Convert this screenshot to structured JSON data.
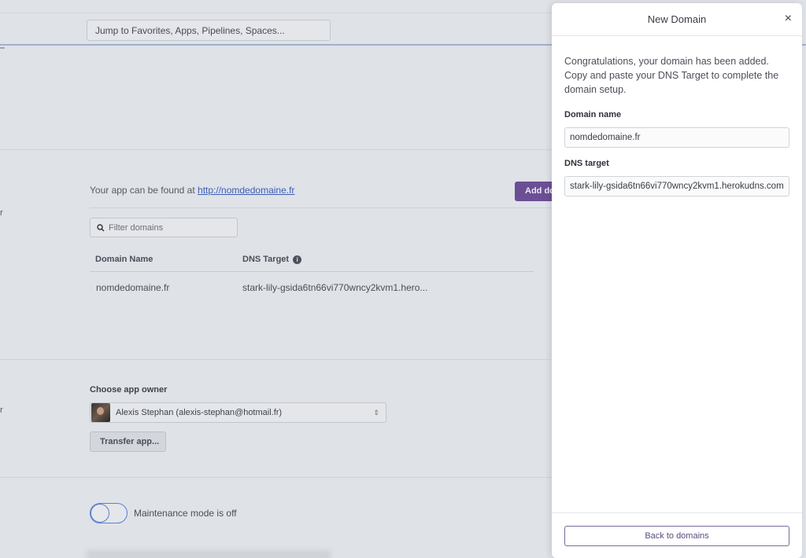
{
  "header": {
    "search_placeholder": "Jump to Favorites, Apps, Pipelines, Spaces..."
  },
  "domains_section": {
    "found_prefix": "Your app can be found at",
    "found_link": "http://nomdedomaine.fr",
    "add_button_label": "Add do",
    "filter_placeholder": "Filter domains",
    "columns": [
      "Domain Name",
      "DNS Target"
    ],
    "rows": [
      {
        "domain": "nomdedomaine.fr",
        "dns_target": "stark-lily-gsida6tn66vi770wncy2kvm1.hero..."
      }
    ]
  },
  "owner_section": {
    "label": "Choose app owner",
    "selected_owner": "Alexis Stephan (alexis-stephan@hotmail.fr)",
    "transfer_button": "Transfer app..."
  },
  "maintenance": {
    "label": "Maintenance mode is off",
    "enabled": false
  },
  "side_letters": [
    "r",
    "r"
  ],
  "modal": {
    "title": "New Domain",
    "close_glyph": "×",
    "message": "Congratulations, your domain has been added. Copy and paste your DNS Target to complete the domain setup.",
    "domain_name_label": "Domain name",
    "domain_name_value": "nomdedomaine.fr",
    "dns_target_label": "DNS target",
    "dns_target_value": "stark-lily-gsida6tn66vi770wncy2kvm1.herokudns.com",
    "back_button": "Back to domains"
  },
  "colors": {
    "accent_purple": "#6a4f95",
    "link_blue": "#3a5db5",
    "toggle_blue": "#5a7fd0"
  }
}
